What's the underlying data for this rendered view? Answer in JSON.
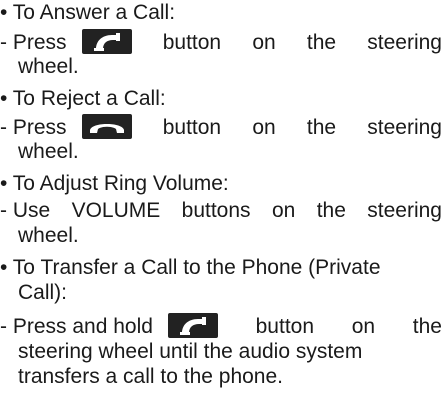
{
  "instructions": {
    "answer": {
      "heading": "• To Answer a Call:",
      "step_prefix": "- Press",
      "step_word_button": "button",
      "step_word_on": "on",
      "step_word_the": "the",
      "step_word_steering": "steering",
      "step_end": "wheel.",
      "icon": "phone-answer-icon"
    },
    "reject": {
      "heading": "• To Reject a Call:",
      "step_prefix": "- Press",
      "step_word_button": "button",
      "step_word_on": "on",
      "step_word_the": "the",
      "step_word_steering": "steering",
      "step_end": "wheel.",
      "icon": "phone-reject-icon"
    },
    "volume": {
      "heading": "• To Adjust Ring Volume:",
      "step_words": [
        "- Use",
        "VOLUME",
        "buttons",
        "on",
        "the",
        "steering"
      ],
      "step_end": "wheel."
    },
    "transfer": {
      "heading_line1": "• To Transfer a Call to the Phone (Private",
      "heading_line2": "Call):",
      "step_prefix": "- Press and hold",
      "step_word_button": "button",
      "step_word_on": "on",
      "step_word_the": "the",
      "step_line2": "steering wheel until the audio system",
      "step_line3": "transfers a call to the phone.",
      "icon": "phone-answer-icon"
    }
  },
  "colors": {
    "text": "#1a1a1a",
    "icon_bg": "#222222",
    "icon_fg": "#ffffff"
  }
}
